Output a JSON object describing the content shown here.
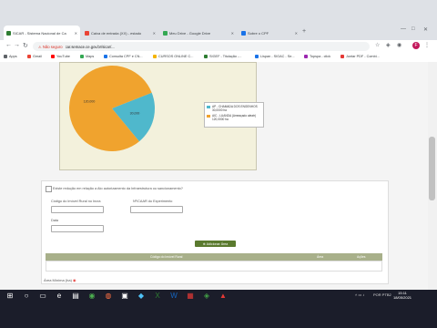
{
  "browser": {
    "tabs": [
      {
        "label": "SICAR - Sistema Nacional de Ca",
        "color": "#2e7d32"
      },
      {
        "label": "Caixa de entrada (XX) - estado",
        "color": "#ea4335"
      },
      {
        "label": "Meu Drive - Google Drive",
        "color": "#34a853"
      },
      {
        "label": "Sobre o CPF",
        "color": "#1a73e8"
      }
    ],
    "warning_label": "Não seguro",
    "url": "car.semace.ce.gov.br/sicar/...",
    "avatar_letter": "F"
  },
  "bookmarks": [
    {
      "label": "Apps",
      "color": "#5f6368"
    },
    {
      "label": "Gmail",
      "color": "#ea4335"
    },
    {
      "label": "YouTube",
      "color": "#ff0000"
    },
    {
      "label": "Maps",
      "color": "#34a853"
    },
    {
      "label": "Consulta CPF e CN...",
      "color": "#1a73e8"
    },
    {
      "label": "CURSOS ONLINE C...",
      "color": "#f4b400"
    },
    {
      "label": "SIGEF - Titulação -...",
      "color": "#2e7d32"
    },
    {
      "label": "Lispan - SIGAC - Se...",
      "color": "#1a73e8"
    },
    {
      "label": "Topspa - click",
      "color": "#9c27b0"
    },
    {
      "label": "Juntar PDF - Combi...",
      "color": "#e53935"
    }
  ],
  "chart_data": {
    "type": "pie",
    "labels": [
      "AP - CHAMADA DOS ENGENHOS",
      "AIC - LUANDA (Ameaçado aleatr)"
    ],
    "values": [
      30,
      120
    ],
    "slice_labels": [
      "30,000",
      "120,000"
    ],
    "legend_values": [
      "30,0000 ha",
      "120,0000 ha"
    ],
    "colors": [
      "#4fb8cc",
      "#f0a32e"
    ],
    "legend_position": "right"
  },
  "form": {
    "question": "Existe redução em relação a Ato autorizamento da Infraestrutura ou sancionamento?",
    "field1_label": "Código do Imóvel Rural no Incra",
    "field2_label": "Nº/CAAR do Experimento",
    "field3_label": "Data",
    "add_button": "Adicionar Área",
    "table_headers": [
      "Código do Imóvel Rural",
      "Área",
      "Ações"
    ],
    "bottom_label": "Área Mínima (ha)"
  },
  "taskbar": {
    "time": "15:11",
    "lang": "POR PTB2",
    "date": "18/05/2021"
  }
}
